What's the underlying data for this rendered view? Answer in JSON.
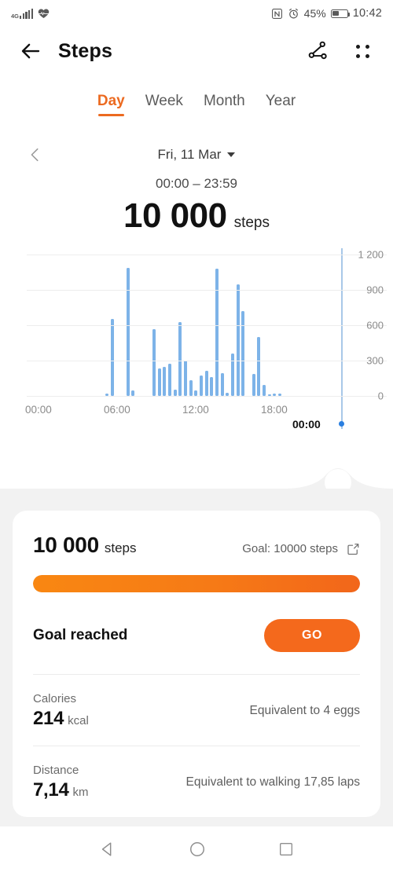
{
  "status_bar": {
    "network_type": "4G",
    "signal_icon": "signal-bars-icon",
    "health_icon": "heart-icon",
    "nfc_icon": "nfc-icon",
    "alarm_icon": "alarm-clock-icon",
    "battery_percent": "45%",
    "battery_icon": "battery-icon",
    "time": "10:42"
  },
  "app_bar": {
    "back_icon": "back-arrow-icon",
    "title": "Steps",
    "share_icon": "share-icon",
    "menu_icon": "grid-menu-icon"
  },
  "tabs": {
    "items": [
      {
        "label": "Day",
        "active": true
      },
      {
        "label": "Week",
        "active": false
      },
      {
        "label": "Month",
        "active": false
      },
      {
        "label": "Year",
        "active": false
      }
    ],
    "active_color": "#ec6a20"
  },
  "date_nav": {
    "prev_icon": "chevron-left-icon",
    "date": "Fri, 11 Mar",
    "dropdown_icon": "caret-down-icon",
    "time_range": "00:00 – 23:59",
    "total_steps": "10 000",
    "total_unit": "steps"
  },
  "chart_data": {
    "type": "bar",
    "title": "",
    "xlabel": "",
    "ylabel": "",
    "ylim": [
      0,
      1200
    ],
    "yticks": [
      "0",
      "300",
      "600",
      "900",
      "1 200"
    ],
    "ytick_values": [
      0,
      300,
      600,
      900,
      1200
    ],
    "xticks": [
      "00:00",
      "06:00",
      "12:00",
      "18:00"
    ],
    "xtick_hours": [
      0,
      6,
      12,
      18
    ],
    "grid": true,
    "legend": "none",
    "bar_color": "#7db3e8",
    "cursor": {
      "label": "00:00",
      "hour": 24,
      "line_color": "#a8c8e8",
      "dot_color": "#2a7fe0"
    },
    "x": [
      6.0,
      6.4,
      7.6,
      8.0,
      9.6,
      10.0,
      10.4,
      10.8,
      11.2,
      11.6,
      12.0,
      12.4,
      12.8,
      13.2,
      13.6,
      14.0,
      14.4,
      14.8,
      15.2,
      15.6,
      16.0,
      16.4,
      17.2,
      17.6,
      18.0,
      18.4,
      18.8,
      19.2,
      19.6,
      20.4,
      21.2,
      21.6
    ],
    "values": [
      18,
      655,
      1090,
      45,
      570,
      235,
      250,
      275,
      55,
      625,
      300,
      135,
      45,
      175,
      215,
      160,
      1080,
      195,
      25,
      360,
      950,
      720,
      190,
      500,
      95,
      12,
      18,
      20,
      0,
      0,
      0,
      0
    ]
  },
  "scroll_handle": {
    "icon": "scroll-handle-circle"
  },
  "summary_card": {
    "steps_value": "10 000",
    "steps_unit": "steps",
    "goal_label": "Goal: 10000 steps",
    "goal_edit_icon": "edit-square-icon",
    "progress_percent": 100,
    "progress_color": "#f4691c",
    "status_text": "Goal reached",
    "go_button_label": "GO",
    "stats": [
      {
        "title": "Calories",
        "value": "214",
        "unit": "kcal",
        "equivalent": "Equivalent to 4 eggs"
      },
      {
        "title": "Distance",
        "value": "7,14",
        "unit": "km",
        "equivalent": "Equivalent to walking 17,85 laps"
      }
    ]
  },
  "nav_bar": {
    "back_icon": "nav-back-triangle-icon",
    "home_icon": "nav-home-circle-icon",
    "recents_icon": "nav-recents-square-icon"
  }
}
